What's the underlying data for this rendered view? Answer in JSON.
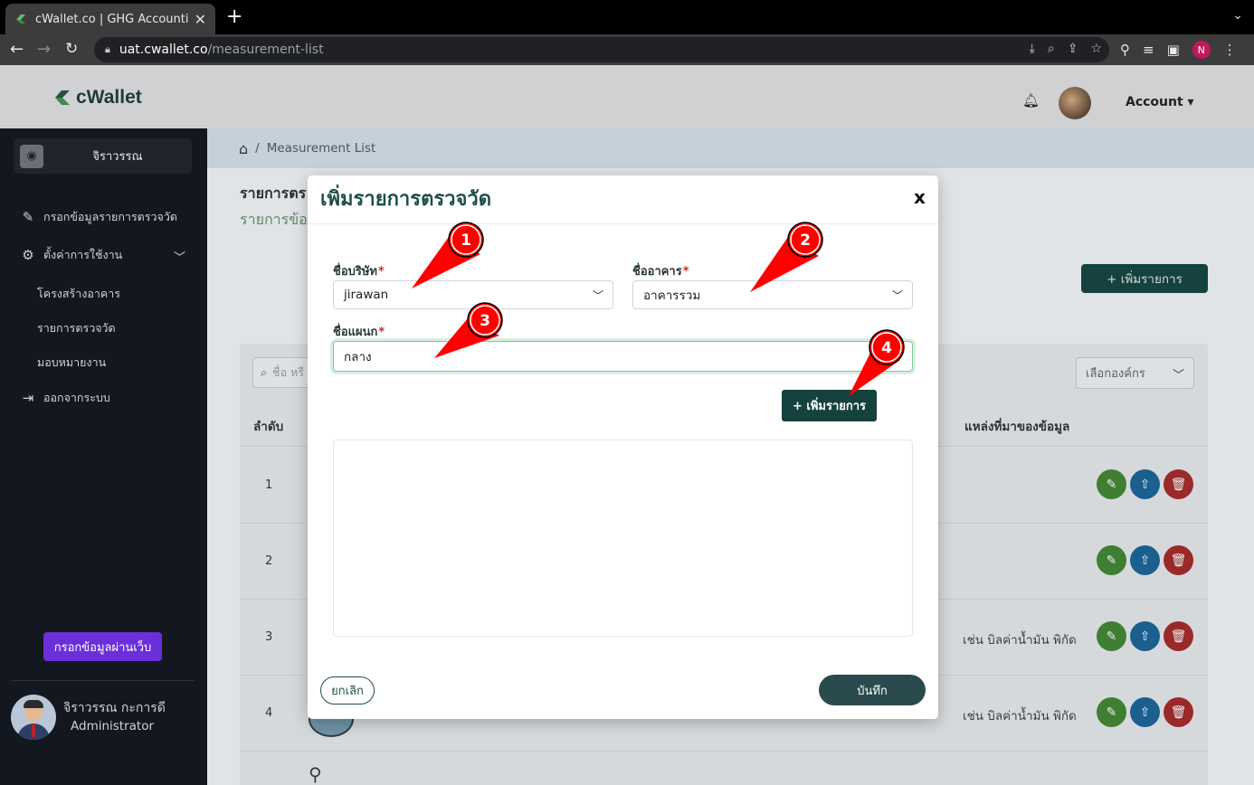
{
  "browser": {
    "tab_title": "cWallet.co | GHG Accounting S",
    "url_host": "uat.cwallet.co",
    "url_path": "/measurement-list",
    "profile_initial": "N"
  },
  "header": {
    "logo_text": "cWallet",
    "account_label": "Account"
  },
  "sidebar": {
    "user_card_name": "จิราวรรณ",
    "items": [
      {
        "label": "กรอกข้อมูลรายการตรวจวัด",
        "icon": "pencil-icon"
      },
      {
        "label": "ตั้งค่าการใช้งาน",
        "icon": "gear-icon"
      },
      {
        "label": "ออกจากระบบ",
        "icon": "logout-icon"
      }
    ],
    "sub_items": [
      "โครงสร้างอาคาร",
      "รายการตรวจวัด",
      "มอบหมายงาน"
    ],
    "web_button": "กรอกข้อมูลผ่านเว็บ",
    "footer_name": "จิราวรรณ กะการดี",
    "footer_role": "Administrator"
  },
  "page": {
    "breadcrumb": "Measurement List",
    "title_partial": "รายการตร",
    "subtitle_partial": "รายการข้อ",
    "add_button": "+ เพิ่มรายการ",
    "search_placeholder": "ชื่อ หรื",
    "org_select": "เลือกองค์กร",
    "columns": [
      "ลำดับ",
      "แหล่งที่มาของข้อมูล"
    ],
    "rows": [
      {
        "num": "1",
        "source": ""
      },
      {
        "num": "2",
        "source": ""
      },
      {
        "num": "3",
        "source": "เช่น บิลค่าน้ำมัน พิกัด"
      },
      {
        "num": "4",
        "source": "เช่น บิลค่าน้ำมัน พิกัด"
      }
    ]
  },
  "modal": {
    "title": "เพิ่มรายการตรวจวัด",
    "close": "x",
    "company_label": "ชื่อบริษัท",
    "company_value": "jirawan",
    "building_label": "ชื่ออาคาร",
    "building_value": "อาคารรวม",
    "department_label": "ชื่อแผนก",
    "department_value": "กลาง",
    "required_mark": "*",
    "add_item_button": "+ เพิ่มรายการ",
    "cancel_button": "ยกเลิก",
    "save_button": "บันทึก"
  },
  "callouts": [
    "1",
    "2",
    "3",
    "4"
  ],
  "colors": {
    "brand_dark": "#15423f",
    "callout_red": "#ff0000",
    "sidebar_bg": "#13171f",
    "web_button": "#6a2fd8"
  }
}
